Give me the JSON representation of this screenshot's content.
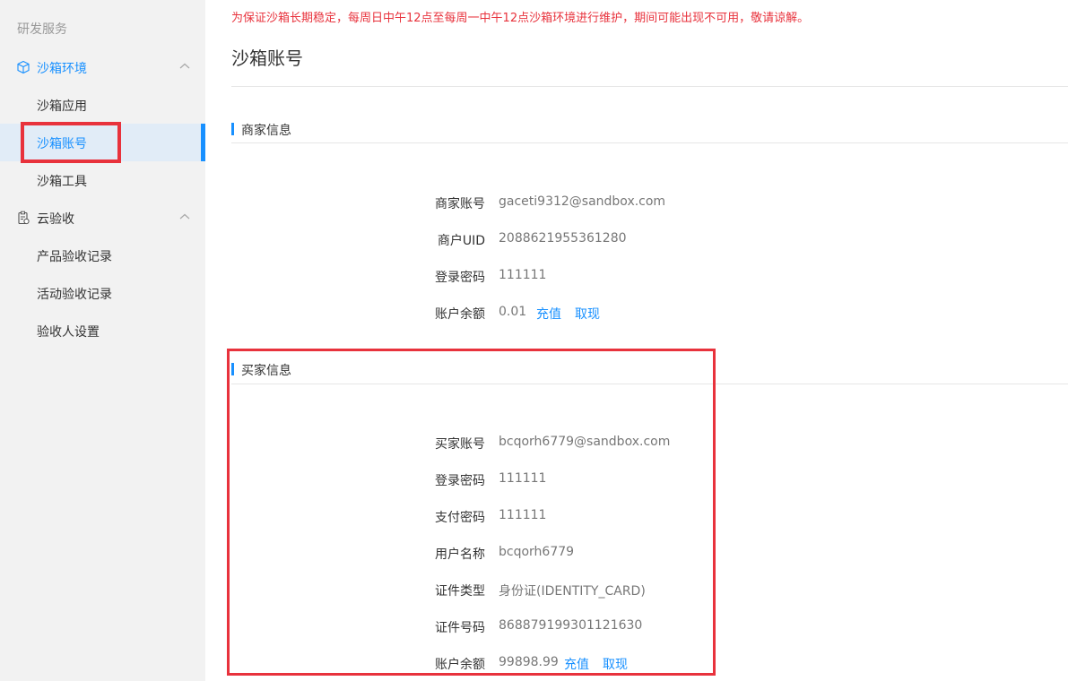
{
  "sidebar": {
    "section_title": "研发服务",
    "groups": [
      {
        "label": "沙箱环境",
        "icon": "cube-icon",
        "expanded": true,
        "active": true,
        "items": [
          {
            "label": "沙箱应用"
          },
          {
            "label": "沙箱账号",
            "selected": true
          },
          {
            "label": "沙箱工具"
          }
        ]
      },
      {
        "label": "云验收",
        "icon": "clipboard-icon",
        "expanded": true,
        "items": [
          {
            "label": "产品验收记录"
          },
          {
            "label": "活动验收记录"
          },
          {
            "label": "验收人设置"
          }
        ]
      }
    ]
  },
  "notice": "为保证沙箱长期稳定，每周日中午12点至每周一中午12点沙箱环境进行维护，期间可能出现不可用，敬请谅解。",
  "page_title": "沙箱账号",
  "merchant": {
    "title": "商家信息",
    "rows": [
      {
        "label": "商家账号",
        "value": "gaceti9312@sandbox.com"
      },
      {
        "label": "商户UID",
        "value": "2088621955361280"
      },
      {
        "label": "登录密码",
        "value": "111111"
      },
      {
        "label": "账户余额",
        "value": "0.01"
      }
    ],
    "recharge": "充值",
    "withdraw": "取现"
  },
  "buyer": {
    "title": "买家信息",
    "rows": [
      {
        "label": "买家账号",
        "value": "bcqorh6779@sandbox.com"
      },
      {
        "label": "登录密码",
        "value": "111111"
      },
      {
        "label": "支付密码",
        "value": "111111"
      },
      {
        "label": "用户名称",
        "value": "bcqorh6779"
      },
      {
        "label": "证件类型",
        "value": "身份证(IDENTITY_CARD)"
      },
      {
        "label": "证件号码",
        "value": "868879199301121630"
      },
      {
        "label": "账户余额",
        "value": "99898.99"
      }
    ],
    "recharge": "充值",
    "withdraw": "取现"
  },
  "colors": {
    "accent": "#1890ff",
    "highlight": "#e8323c",
    "notice": "#e8323c"
  }
}
